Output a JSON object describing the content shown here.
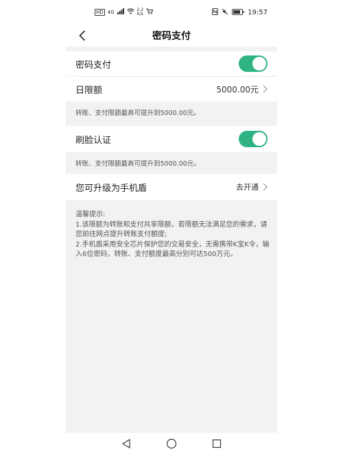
{
  "status_bar": {
    "left_chip": "HD",
    "signal_label": "4G",
    "speed_value": "2.2",
    "speed_unit": "K/s",
    "time": "19:57"
  },
  "header": {
    "title": "密码支付"
  },
  "settings": {
    "password_pay": {
      "label": "密码支付",
      "enabled": true
    },
    "daily_limit": {
      "label": "日限额",
      "value": "5000.00元"
    },
    "note_1": "转账、支付限额最高可提升到5000.00元。",
    "face_auth": {
      "label": "刷脸认证",
      "enabled": true
    },
    "note_2": "转账、支付限额最高可提升到5000.00元。",
    "upgrade": {
      "label": "您可升级为手机盾",
      "action": "去开通"
    }
  },
  "tips": {
    "title": "温馨提示:",
    "line1": "1.该限额为转账和支付共享限额，若限额无法满足您的需求，请您前往网点提升转账支付额度;",
    "line2": "2.手机盾采用安全芯片保护您的交易安全，无需携带K宝K令，输入6位密码，转账、支付额度最高分别可达500万元。"
  },
  "colors": {
    "accent": "#2fb383",
    "background": "#f2f2f2"
  }
}
